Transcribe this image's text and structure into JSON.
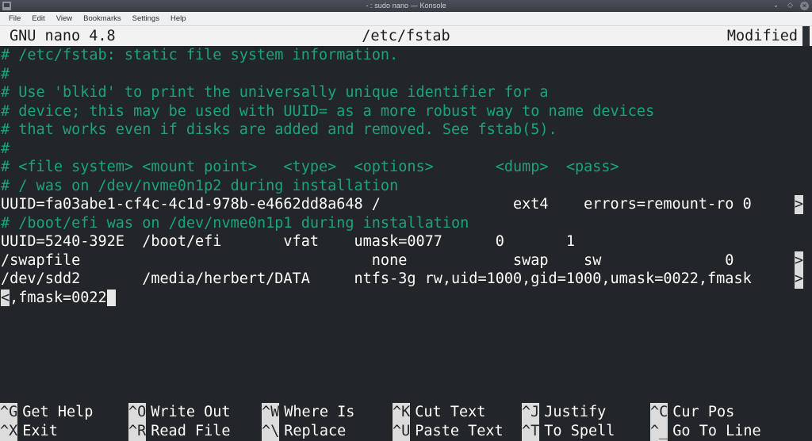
{
  "window": {
    "title": "- : sudo nano — Konsole",
    "icon": "konsole-icon",
    "buttons": [
      {
        "name": "minimize-button",
        "glyph": "⌄"
      },
      {
        "name": "maximize-button",
        "glyph": "◇"
      },
      {
        "name": "close-button",
        "glyph": "✕"
      }
    ]
  },
  "menubar": {
    "items": [
      {
        "label": "File",
        "name": "menu-file"
      },
      {
        "label": "Edit",
        "name": "menu-edit"
      },
      {
        "label": "View",
        "name": "menu-view"
      },
      {
        "label": "Bookmarks",
        "name": "menu-bookmarks"
      },
      {
        "label": "Settings",
        "name": "menu-settings"
      },
      {
        "label": "Help",
        "name": "menu-help"
      }
    ]
  },
  "nano": {
    "version": "GNU nano 4.8",
    "filename": "/etc/fstab",
    "state": "Modified",
    "lines": [
      {
        "text": "# /etc/fstab: static file system information.",
        "class": "c-comment"
      },
      {
        "text": "#",
        "class": "c-comment"
      },
      {
        "text": "# Use 'blkid' to print the universally unique identifier for a",
        "class": "c-comment"
      },
      {
        "text": "# device; this may be used with UUID= as a more robust way to name devices",
        "class": "c-comment"
      },
      {
        "text": "# that works even if disks are added and removed. See fstab(5).",
        "class": "c-comment"
      },
      {
        "text": "#",
        "class": "c-comment"
      },
      {
        "text": "# <file system> <mount point>   <type>  <options>       <dump>  <pass>",
        "class": "c-comment"
      },
      {
        "text": "# / was on /dev/nvme0n1p2 during installation",
        "class": "c-comment"
      },
      {
        "text": "UUID=fa03abe1-cf4c-4c1d-978b-e4662dd8a648 /               ext4    errors=remount-ro 0",
        "class": "c-text",
        "overflow_right": ">"
      },
      {
        "text": "# /boot/efi was on /dev/nvme0n1p1 during installation",
        "class": "c-comment"
      },
      {
        "text": "UUID=5240-392E  /boot/efi       vfat    umask=0077      0       1",
        "class": "c-text"
      },
      {
        "text": "/swapfile                                 none            swap    sw              0",
        "class": "c-text",
        "overflow_right": ">"
      },
      {
        "text": "/dev/sdd2       /media/herbert/DATA     ntfs-3g rw,uid=1000,gid=1000,umask=0022,fmask",
        "class": "c-text",
        "overflow_right": ">"
      },
      {
        "text": ",fmask=0022",
        "class": "c-text",
        "overflow_left": "<",
        "cursor_after": true
      }
    ]
  },
  "shortcuts": {
    "row1": [
      {
        "key": "^G",
        "label": "Get Help",
        "name": "shortcut-get-help"
      },
      {
        "key": "^O",
        "label": "Write Out",
        "name": "shortcut-write-out"
      },
      {
        "key": "^W",
        "label": "Where Is",
        "name": "shortcut-where-is"
      },
      {
        "key": "^K",
        "label": "Cut Text",
        "name": "shortcut-cut-text"
      },
      {
        "key": "^J",
        "label": "Justify",
        "name": "shortcut-justify"
      },
      {
        "key": "^C",
        "label": "Cur Pos",
        "name": "shortcut-cur-pos"
      }
    ],
    "row2": [
      {
        "key": "^X",
        "label": "Exit",
        "name": "shortcut-exit"
      },
      {
        "key": "^R",
        "label": "Read File",
        "name": "shortcut-read-file"
      },
      {
        "key": "^\\",
        "label": "Replace",
        "name": "shortcut-replace"
      },
      {
        "key": "^U",
        "label": "Paste Text",
        "name": "shortcut-paste-text"
      },
      {
        "key": "^T",
        "label": "To Spell",
        "name": "shortcut-to-spell"
      },
      {
        "key": "^_",
        "label": "Go To Line",
        "name": "shortcut-go-to-line"
      }
    ],
    "column_offsets": [
      0,
      162,
      330,
      495,
      658,
      820
    ]
  },
  "colors": {
    "terminal_bg": "#232629",
    "comment": "#1ba47b",
    "text": "#fcfcfc",
    "reverse_bg": "#dcdcdc",
    "titlebar_bg": "#f2f2f2"
  }
}
